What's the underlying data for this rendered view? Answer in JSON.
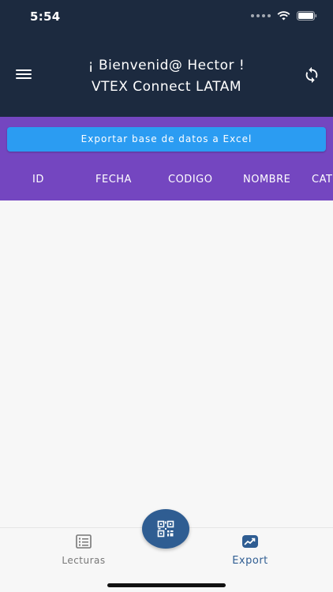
{
  "status_bar": {
    "time": "5:54"
  },
  "header": {
    "greeting": "¡ Bienvenid@ Hector !",
    "subtitle": "VTEX Connect LATAM",
    "menu_icon": "hamburger-menu-icon",
    "sync_icon": "sync-icon"
  },
  "actions": {
    "export_label": "Exportar base de datos a Excel"
  },
  "table": {
    "columns": [
      "ID",
      "FECHA",
      "CODIGO",
      "NOMBRE",
      "CAT"
    ]
  },
  "bottom_nav": {
    "tabs": [
      {
        "label": "Lecturas",
        "icon": "list-icon",
        "active": false
      },
      {
        "label": "Export",
        "icon": "chart-icon",
        "active": true
      }
    ],
    "fab_icon": "qr-code-icon"
  },
  "colors": {
    "header_bg": "#1c2a3f",
    "purple_bg": "#7446c0",
    "button_blue": "#2b9cf2",
    "accent": "#2f5d92"
  }
}
